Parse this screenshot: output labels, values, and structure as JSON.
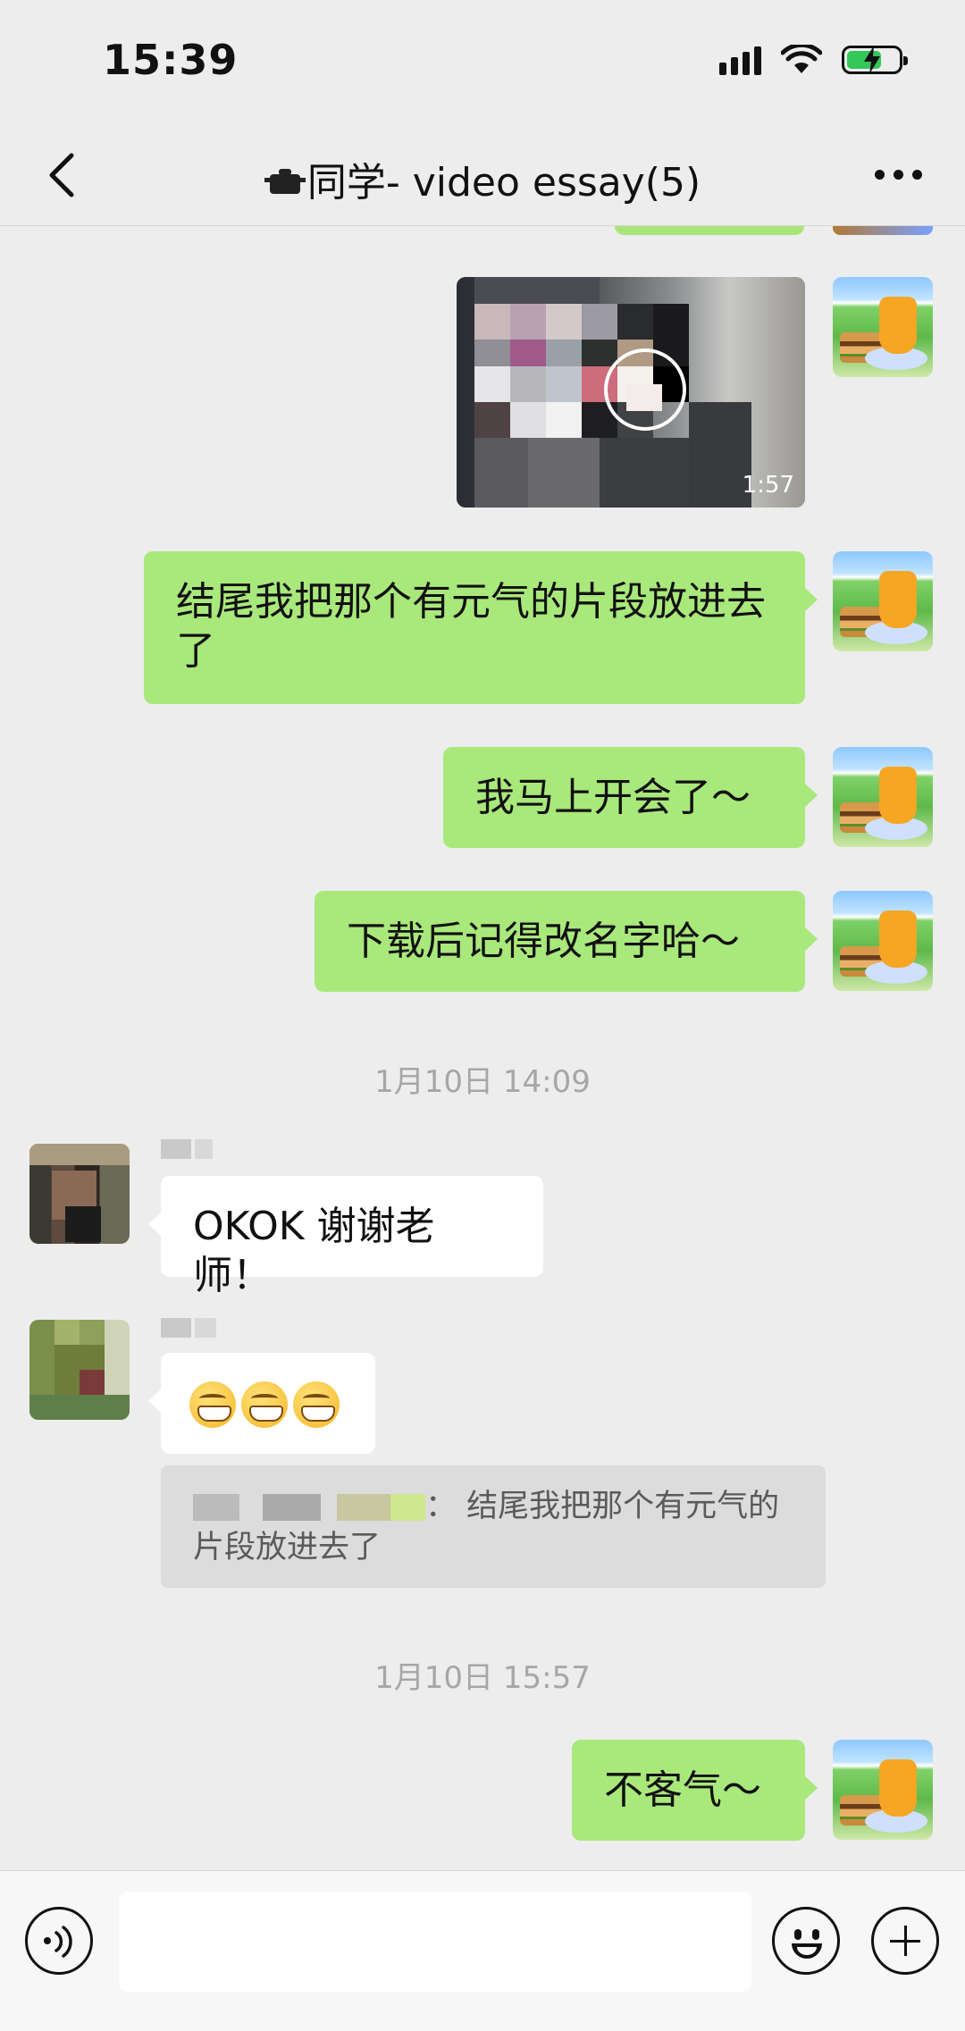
{
  "status_bar": {
    "time": "15:39",
    "icons": [
      "signal-icon",
      "wifi-icon",
      "battery-charging-icon"
    ]
  },
  "nav": {
    "title": "同学- video essay(5)",
    "title_emoji": "pot-icon",
    "back_icon": "chevron-left-icon",
    "more_icon": "more-icon"
  },
  "colors": {
    "my_bubble": "#a9e87b",
    "their_bubble": "#ffffff",
    "background": "#ededed",
    "timestamp": "#a6a6a6"
  },
  "messages": [
    {
      "sender": "me",
      "type": "video",
      "duration": "1:57"
    },
    {
      "sender": "me",
      "type": "text",
      "text": "结尾我把那个有元气的片段放进去了"
    },
    {
      "sender": "me",
      "type": "text",
      "text": "我马上开会了～"
    },
    {
      "sender": "me",
      "type": "text",
      "text": "下载后记得改名字哈～"
    },
    {
      "type": "timestamp",
      "text": "1月10日 14:09"
    },
    {
      "sender": "member1",
      "type": "text",
      "text": "OKOK 谢谢老师！"
    },
    {
      "sender": "member2",
      "type": "emoji",
      "emojis": [
        "grinning-face-icon",
        "grinning-face-icon",
        "grinning-face-icon"
      ]
    },
    {
      "type": "quote",
      "quote_text": "：  结尾我把那个有元气的片段放进去了"
    },
    {
      "type": "timestamp",
      "text": "1月10日 15:57"
    },
    {
      "sender": "me",
      "type": "text",
      "text": "不客气～"
    }
  ],
  "input_bar": {
    "voice_icon": "voice-icon",
    "emoji_icon": "emoji-icon",
    "plus_icon": "plus-icon",
    "input_value": ""
  }
}
